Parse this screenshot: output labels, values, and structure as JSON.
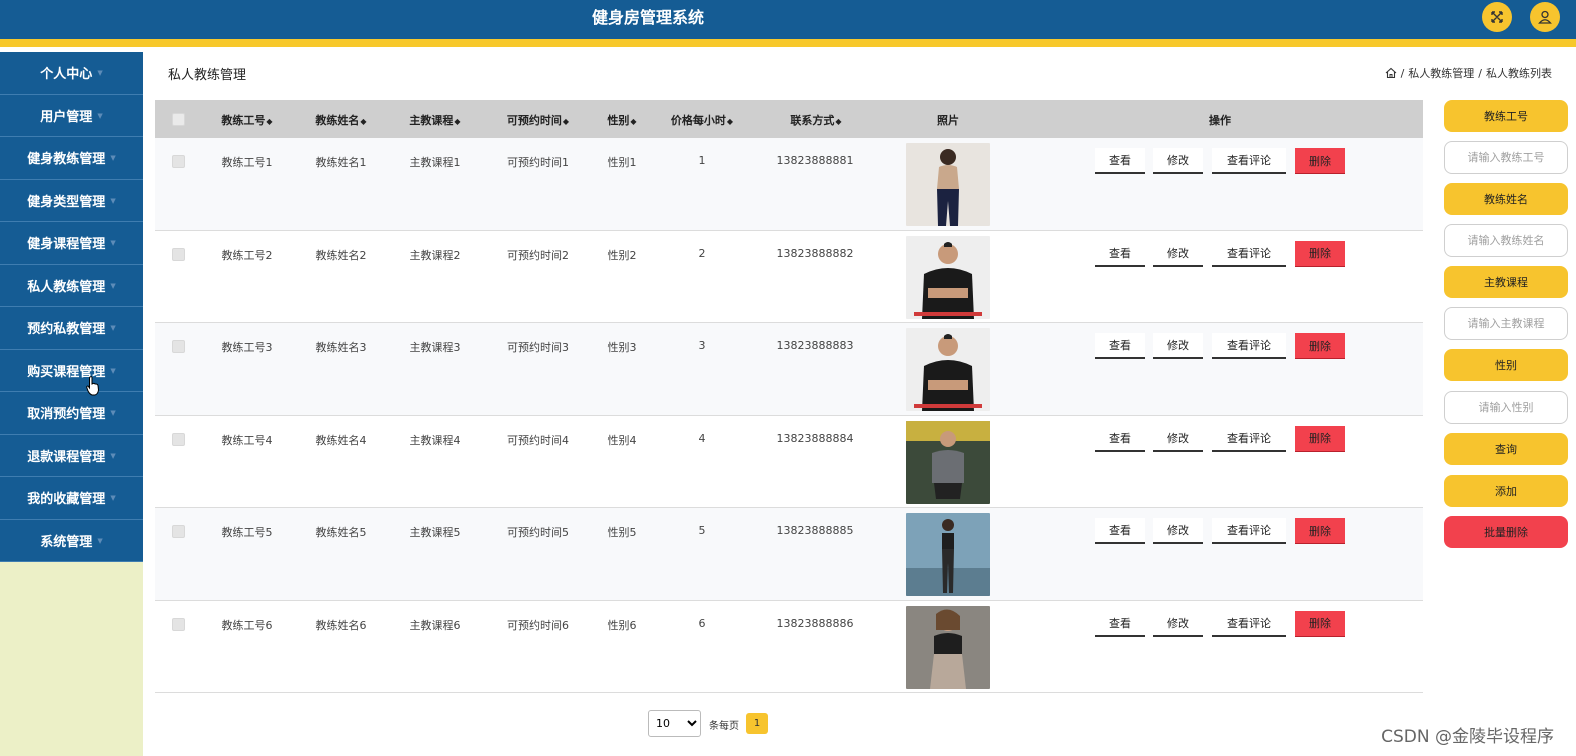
{
  "header": {
    "title": "健身房管理系统",
    "fullscreen_icon": "fullscreen-icon",
    "user_icon": "user-icon",
    "accent": "#f7c42e",
    "bar_color": "#155c94"
  },
  "sidebar": {
    "items": [
      {
        "label": "个人中心"
      },
      {
        "label": "用户管理"
      },
      {
        "label": "健身教练管理"
      },
      {
        "label": "健身类型管理"
      },
      {
        "label": "健身课程管理"
      },
      {
        "label": "私人教练管理"
      },
      {
        "label": "预约私教管理"
      },
      {
        "label": "购买课程管理"
      },
      {
        "label": "取消预约管理"
      },
      {
        "label": "退款课程管理"
      },
      {
        "label": "我的收藏管理"
      },
      {
        "label": "系统管理"
      }
    ]
  },
  "page": {
    "title": "私人教练管理"
  },
  "breadcrumb": {
    "home_icon": "home-icon",
    "sep1": "/",
    "level1": "私人教练管理",
    "sep2": "/",
    "level2": "私人教练列表"
  },
  "table": {
    "headers": {
      "id": "教练工号",
      "name": "教练姓名",
      "course": "主教课程",
      "time": "可预约时间",
      "gender": "性别",
      "price": "价格每小时",
      "phone": "联系方式",
      "photo": "照片",
      "actions": "操作"
    },
    "action_labels": {
      "view": "查看",
      "edit": "修改",
      "comments": "查看评论",
      "delete": "删除"
    },
    "rows": [
      {
        "id": "教练工号1",
        "name": "教练姓名1",
        "course": "主教课程1",
        "time": "可预约时间1",
        "gender": "性别1",
        "price": "1",
        "phone": "13823888881"
      },
      {
        "id": "教练工号2",
        "name": "教练姓名2",
        "course": "主教课程2",
        "time": "可预约时间2",
        "gender": "性别2",
        "price": "2",
        "phone": "13823888882"
      },
      {
        "id": "教练工号3",
        "name": "教练姓名3",
        "course": "主教课程3",
        "time": "可预约时间3",
        "gender": "性别3",
        "price": "3",
        "phone": "13823888883"
      },
      {
        "id": "教练工号4",
        "name": "教练姓名4",
        "course": "主教课程4",
        "time": "可预约时间4",
        "gender": "性别4",
        "price": "4",
        "phone": "13823888884"
      },
      {
        "id": "教练工号5",
        "name": "教练姓名5",
        "course": "主教课程5",
        "time": "可预约时间5",
        "gender": "性别5",
        "price": "5",
        "phone": "13823888885"
      },
      {
        "id": "教练工号6",
        "name": "教练姓名6",
        "course": "主教课程6",
        "time": "可预约时间6",
        "gender": "性别6",
        "price": "6",
        "phone": "13823888886"
      }
    ]
  },
  "search_panel": {
    "id_label": "教练工号",
    "id_placeholder": "请输入教练工号",
    "name_label": "教练姓名",
    "name_placeholder": "请输入教练姓名",
    "course_label": "主教课程",
    "course_placeholder": "请输入主教课程",
    "gender_label": "性别",
    "gender_placeholder": "请输入性别",
    "query_label": "查询",
    "add_label": "添加",
    "batch_delete_label": "批量删除"
  },
  "pagination": {
    "page_size": "10",
    "per_page_text": "条每页",
    "current_page": "1"
  },
  "watermark": "CSDN @金陵毕设程序"
}
